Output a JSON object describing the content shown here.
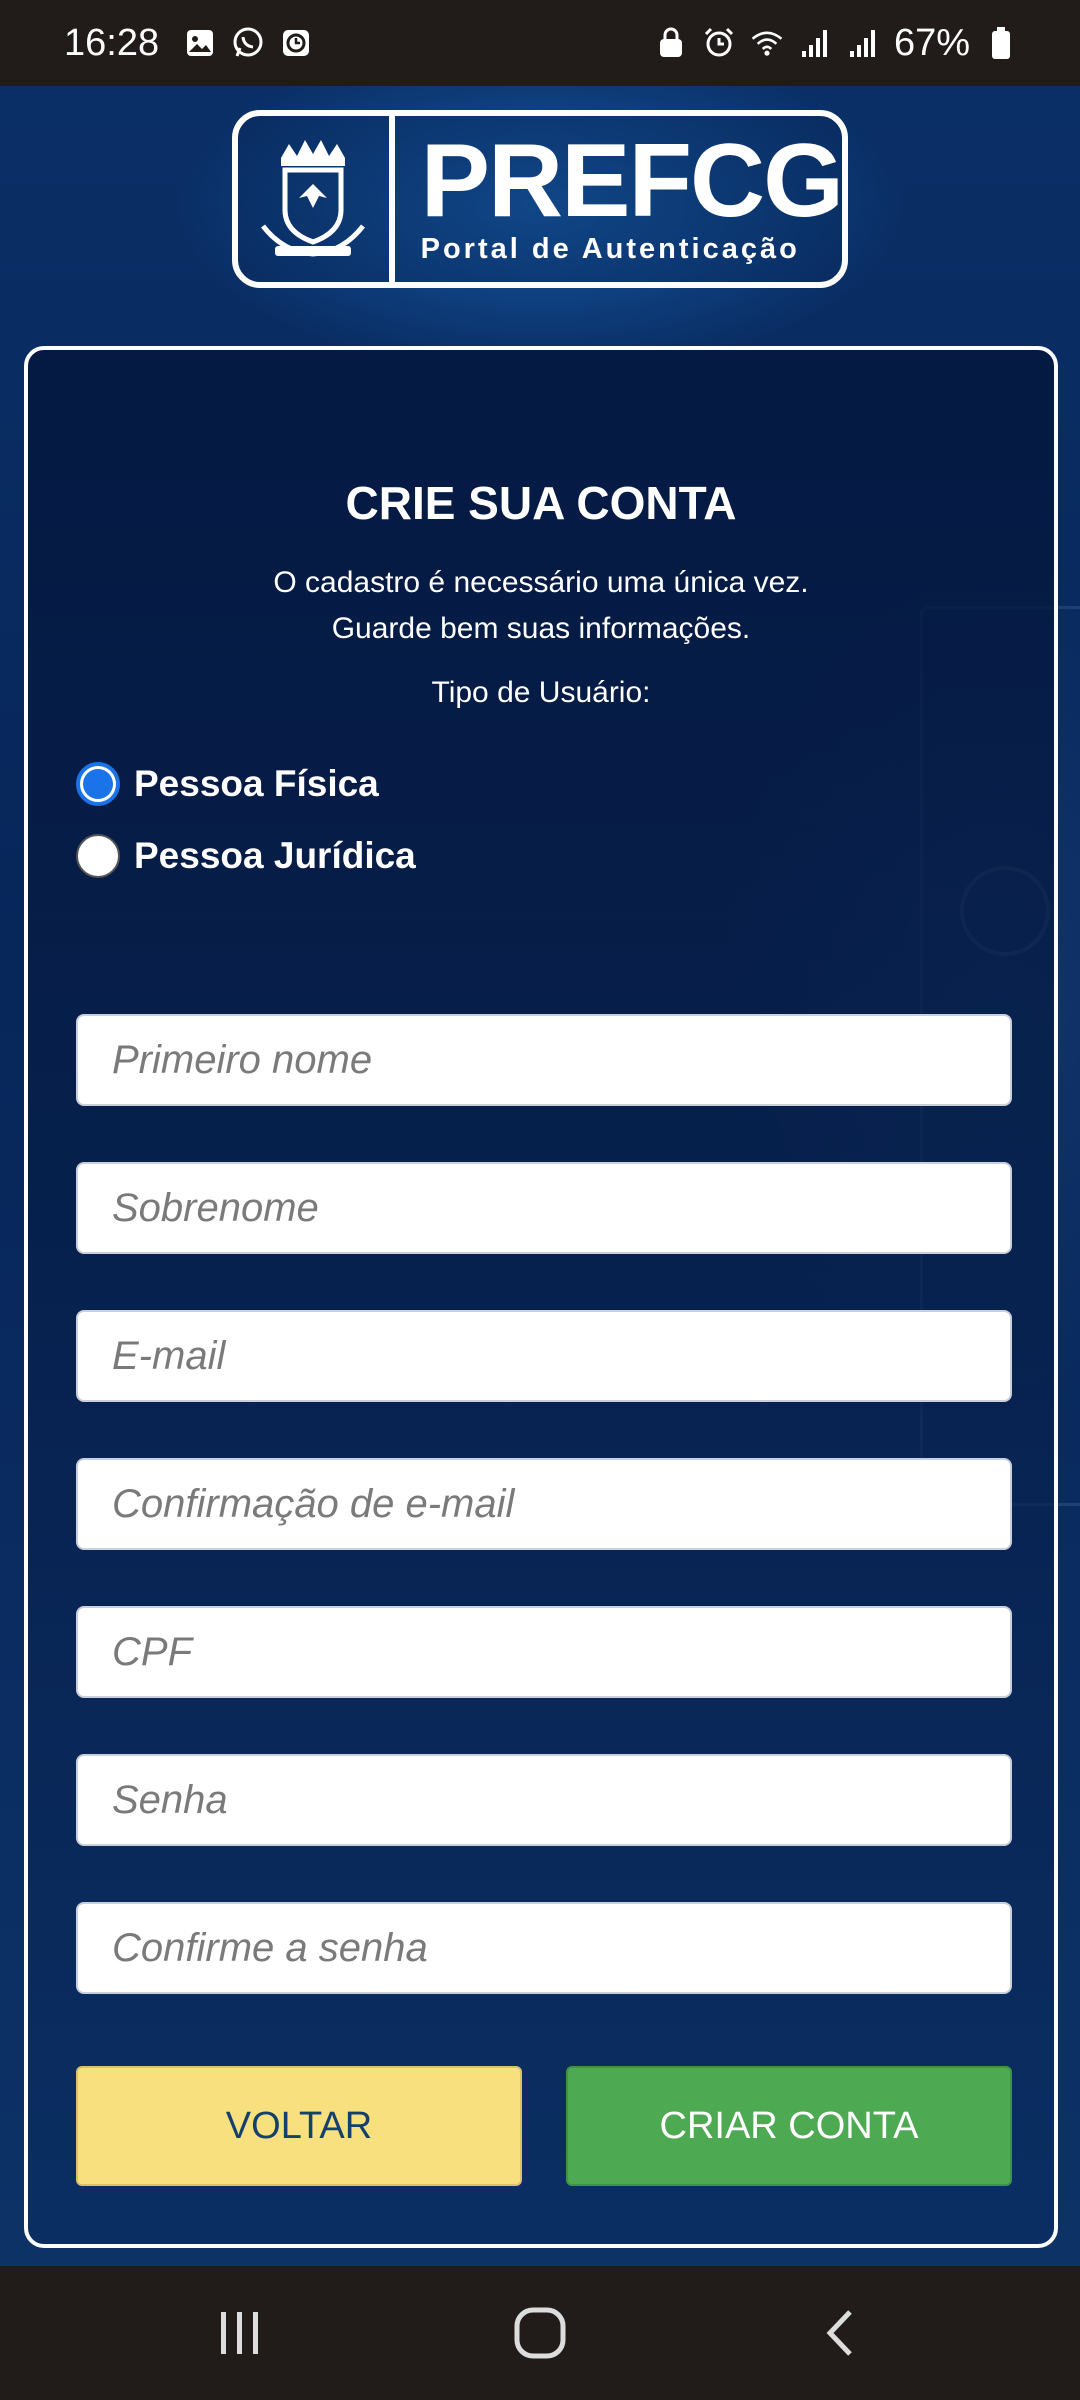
{
  "status_bar": {
    "time": "16:28",
    "battery": "67%",
    "left_icons": [
      "gallery-icon",
      "whatsapp-icon",
      "clock-app-icon"
    ],
    "right_icons": [
      "lock-icon",
      "alarm-icon",
      "wifi-icon",
      "signal-icon",
      "signal-icon",
      "battery-icon"
    ]
  },
  "logo": {
    "title": "PREFCG",
    "subtitle": "Portal de Autenticação"
  },
  "form": {
    "title": "CRIE SUA CONTA",
    "description_line1": "O cadastro é necessário uma única vez.",
    "description_line2": "Guarde bem suas informações.",
    "user_type_label": "Tipo de Usuário:",
    "user_types": [
      {
        "label": "Pessoa Física",
        "selected": true
      },
      {
        "label": "Pessoa Jurídica",
        "selected": false
      }
    ],
    "fields": [
      {
        "placeholder": "Primeiro nome",
        "value": ""
      },
      {
        "placeholder": "Sobrenome",
        "value": ""
      },
      {
        "placeholder": "E-mail",
        "value": ""
      },
      {
        "placeholder": "Confirmação de e-mail",
        "value": ""
      },
      {
        "placeholder": "CPF",
        "value": ""
      },
      {
        "placeholder": "Senha",
        "value": ""
      },
      {
        "placeholder": "Confirme a senha",
        "value": ""
      }
    ],
    "back_label": "VOLTAR",
    "create_label": "CRIAR CONTA"
  },
  "colors": {
    "background": "#0a2652",
    "back_button": "#f7e07d",
    "create_button": "#4daa52",
    "radio_selected": "#1a73e8"
  },
  "nav_bar": [
    "recent-apps-icon",
    "home-icon",
    "back-icon"
  ]
}
